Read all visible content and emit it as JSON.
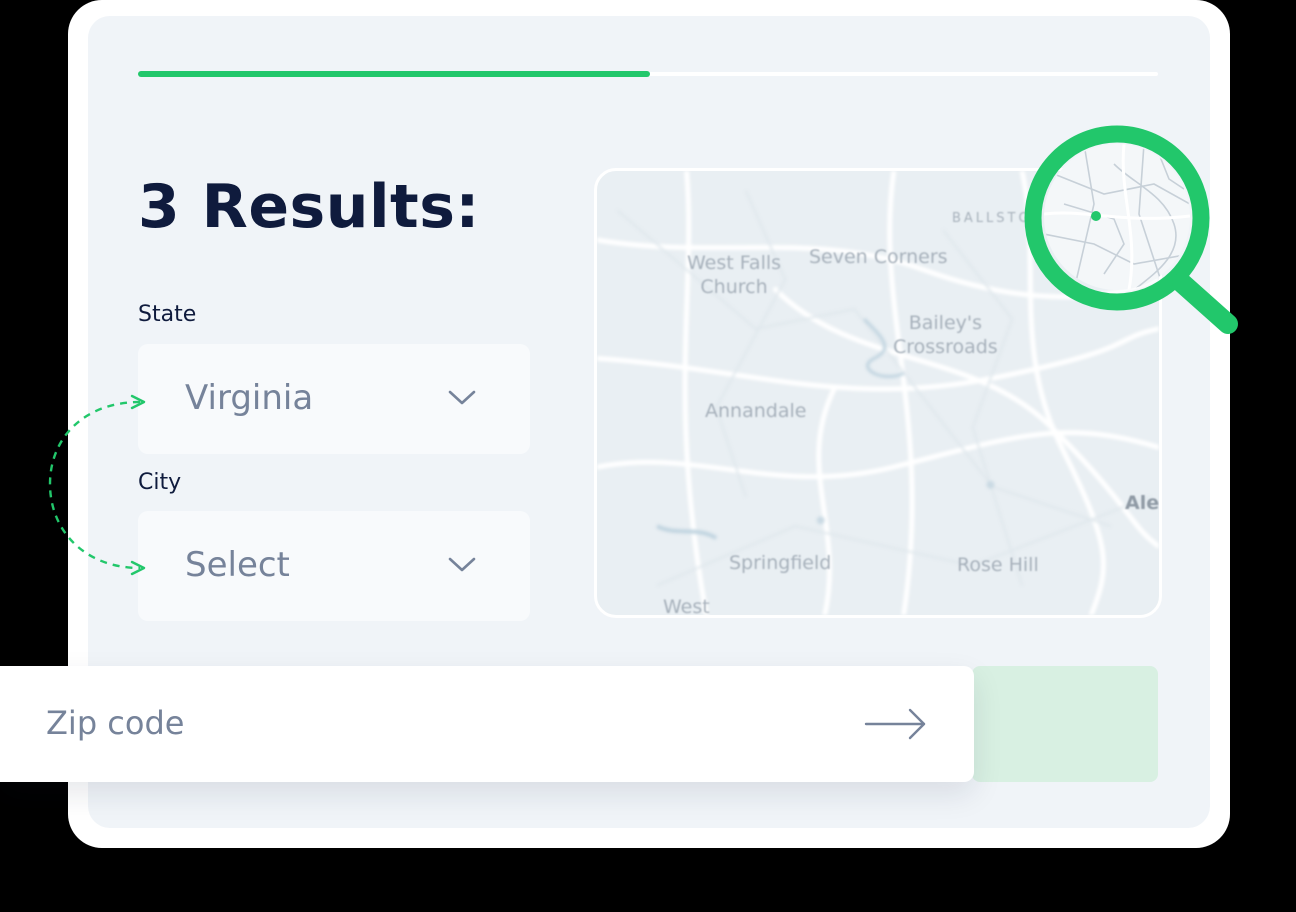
{
  "header": {
    "progress_percent": 50.2
  },
  "results": {
    "title": "3 Results:"
  },
  "form": {
    "state": {
      "label": "State",
      "value": "Virginia"
    },
    "city": {
      "label": "City",
      "value": "Select"
    },
    "zip": {
      "placeholder": "Zip code"
    }
  },
  "map": {
    "labels": {
      "ballston": "BALLSTON",
      "west_falls_church": "West Falls\nChurch",
      "seven_corners": "Seven Corners",
      "baileys": "Bailey's\nCrossroads",
      "annandale": "Annandale",
      "springfield": "Springfield",
      "rose_hill": "Rose Hill",
      "alexandria": "Ale",
      "west": "West"
    }
  },
  "colors": {
    "accent": "#22c76b",
    "title": "#0f1b3d",
    "muted": "#76839a",
    "panel": "#f0f4f8",
    "submit_bg": "#d8f0e2"
  },
  "icons": {
    "select_chevron": "chevron-down-icon",
    "zip_submit": "arrow-right-icon",
    "magnifier": "magnifier-icon",
    "connector": "dashed-arrow-connector"
  }
}
